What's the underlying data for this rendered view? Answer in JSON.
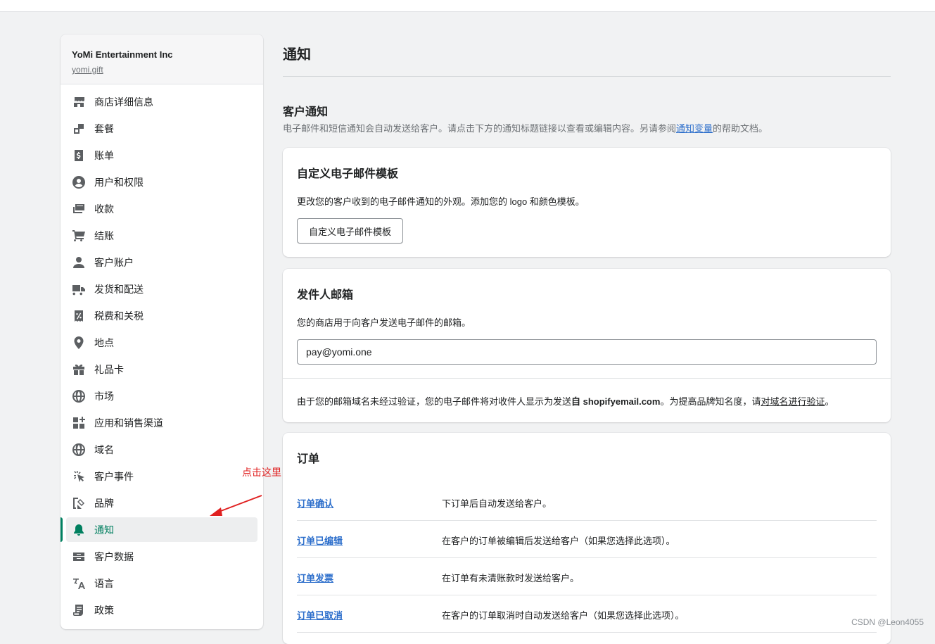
{
  "store": {
    "name": "YoMi Entertainment Inc",
    "domain": "yomi.gift"
  },
  "sidebar": {
    "items": [
      {
        "label": "商店详细信息",
        "icon": "store-icon",
        "active": false
      },
      {
        "label": "套餐",
        "icon": "plan-icon",
        "active": false
      },
      {
        "label": "账单",
        "icon": "billing-icon",
        "active": false
      },
      {
        "label": "用户和权限",
        "icon": "user-icon",
        "active": false
      },
      {
        "label": "收款",
        "icon": "payments-icon",
        "active": false
      },
      {
        "label": "结账",
        "icon": "cart-icon",
        "active": false
      },
      {
        "label": "客户账户",
        "icon": "person-icon",
        "active": false
      },
      {
        "label": "发货和配送",
        "icon": "truck-icon",
        "active": false
      },
      {
        "label": "税费和关税",
        "icon": "tax-icon",
        "active": false
      },
      {
        "label": "地点",
        "icon": "location-icon",
        "active": false
      },
      {
        "label": "礼品卡",
        "icon": "gift-icon",
        "active": false
      },
      {
        "label": "市场",
        "icon": "globe-icon",
        "active": false
      },
      {
        "label": "应用和销售渠道",
        "icon": "apps-icon",
        "active": false
      },
      {
        "label": "域名",
        "icon": "globe-icon",
        "active": false
      },
      {
        "label": "客户事件",
        "icon": "cursor-icon",
        "active": false
      },
      {
        "label": "品牌",
        "icon": "brand-icon",
        "active": false
      },
      {
        "label": "通知",
        "icon": "bell-icon",
        "active": true
      },
      {
        "label": "客户数据",
        "icon": "data-icon",
        "active": false
      },
      {
        "label": "语言",
        "icon": "translate-icon",
        "active": false
      },
      {
        "label": "政策",
        "icon": "policy-icon",
        "active": false
      }
    ]
  },
  "main": {
    "title": "通知",
    "customer_notifications": {
      "title": "客户通知",
      "desc_prefix": "电子邮件和短信通知会自动发送给客户。请点击下方的通知标题链接以查看或编辑内容。另请参阅",
      "desc_link": "通知变量",
      "desc_suffix": "的帮助文档。"
    },
    "template_card": {
      "title": "自定义电子邮件模板",
      "desc": "更改您的客户收到的电子邮件通知的外观。添加您的 logo 和颜色模板。",
      "button": "自定义电子邮件模板"
    },
    "sender_card": {
      "title": "发件人邮箱",
      "desc": "您的商店用于向客户发送电子邮件的邮箱。",
      "email_value": "pay@yomi.one",
      "footer_prefix": "由于您的邮箱域名未经过验证，您的电子邮件将对收件人显示为发送",
      "footer_bold": "自 shopifyemail.com",
      "footer_middle": "。为提高品牌知名度，请",
      "footer_link": "对域名进行验证",
      "footer_end": "。"
    },
    "orders_card": {
      "title": "订单",
      "rows": [
        {
          "name": "订单确认",
          "desc": "下订单后自动发送给客户。"
        },
        {
          "name": "订单已编辑",
          "desc": "在客户的订单被编辑后发送给客户（如果您选择此选项）。"
        },
        {
          "name": "订单发票",
          "desc": "在订单有未清账款时发送给客户。"
        },
        {
          "name": "订单已取消",
          "desc": "在客户的订单取消时自动发送给客户（如果您选择此选项）。"
        }
      ]
    }
  },
  "annotation": {
    "text": "点击这里",
    "color": "#e02020"
  },
  "watermark": "CSDN @Leon4055",
  "colors": {
    "accent": "#008060",
    "link": "#2c6ecb",
    "background": "#f1f2f3"
  }
}
